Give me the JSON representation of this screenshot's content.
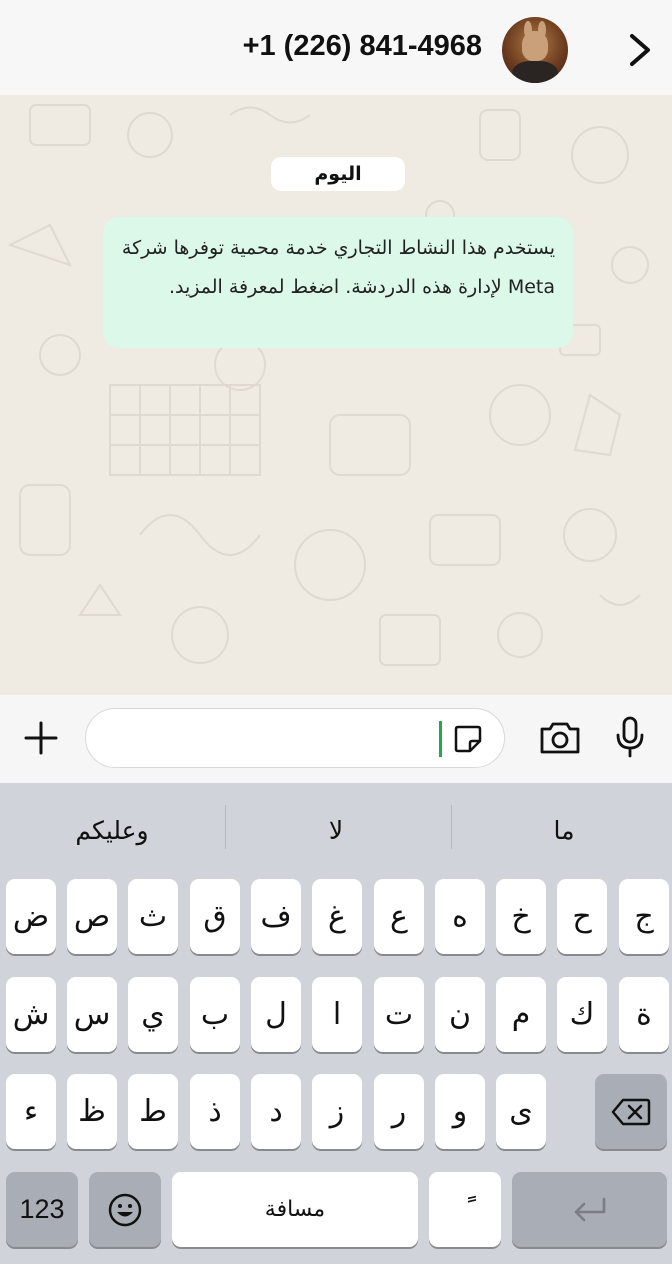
{
  "header": {
    "title": "+1 (226) 841-4968",
    "back_icon": "chevron-right-icon",
    "avatar_icon": "contact-avatar"
  },
  "chat": {
    "date_chip": "اليوم",
    "system_message": "يستخدم هذا النشاط التجاري خدمة محمية توفرها شركة Meta لإدارة هذه الدردشة. اضغط لمعرفة المزيد."
  },
  "input_bar": {
    "message_value": "",
    "icons": [
      "plus-icon",
      "sticker-icon",
      "camera-icon",
      "microphone-icon"
    ]
  },
  "keyboard": {
    "suggestions": [
      "ما",
      "لا",
      "وعليكم"
    ],
    "row1": [
      "ج",
      "ح",
      "خ",
      "ه",
      "ع",
      "غ",
      "ف",
      "ق",
      "ث",
      "ص",
      "ض"
    ],
    "row2": [
      "ة",
      "ك",
      "م",
      "ن",
      "ت",
      "ا",
      "ل",
      "ب",
      "ي",
      "س",
      "ش"
    ],
    "row3": [
      "ى",
      "و",
      "ر",
      "ز",
      "د",
      "ذ",
      "ط",
      "ظ",
      "ء"
    ],
    "numbers_label": "123",
    "space_label": "مسافة",
    "diacritic_label": "ًً",
    "emoji_icon": "emoji-icon",
    "backspace_icon": "backspace-icon",
    "return_icon": "return-icon"
  },
  "colors": {
    "chat_background": "#efeae2",
    "system_bubble": "#dcf8e8",
    "cursor": "#1ea952",
    "keyboard_background": "#d0d3d9"
  }
}
